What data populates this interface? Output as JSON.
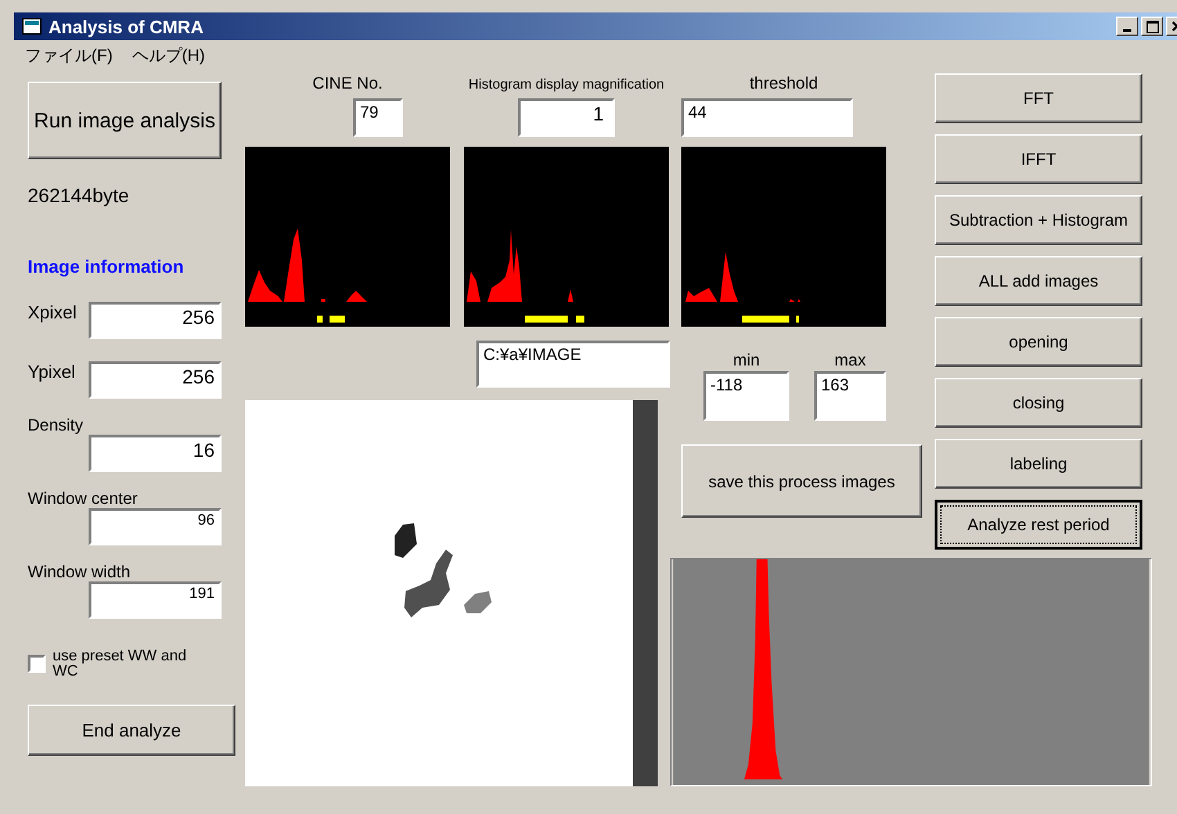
{
  "window": {
    "title": "Analysis of CMRA"
  },
  "menu": [
    {
      "label": "ファイル(F)"
    },
    {
      "label": "ヘルプ(H)"
    }
  ],
  "run_button": "Run image analysis",
  "file_size": "262144byte",
  "image_info_heading": "Image information",
  "info_fields": [
    {
      "label": "Xpixel",
      "value": "256",
      "kind": "inline"
    },
    {
      "label": "Ypixel",
      "value": "256",
      "kind": "inline"
    },
    {
      "label": "Density",
      "value": "16",
      "kind": "stacked"
    },
    {
      "label": "Window center",
      "value": "96",
      "kind": "stacked"
    },
    {
      "label": "Window width",
      "value": "191",
      "kind": "stacked"
    }
  ],
  "preset_checkbox": {
    "label": "use preset WW and WC",
    "checked": false
  },
  "end_button": "End analyze",
  "top_fields": [
    {
      "label": "CINE No.",
      "value": "79"
    },
    {
      "label": "Histogram display magnification",
      "value": "1"
    },
    {
      "label": "threshold",
      "value": "44"
    }
  ],
  "path_field": "C:¥a¥IMAGE",
  "range": [
    {
      "label": "min",
      "value": "-118"
    },
    {
      "label": "max",
      "value": "163"
    }
  ],
  "save_button": "save this process images",
  "actions": [
    {
      "label": "FFT",
      "focused": false
    },
    {
      "label": "IFFT",
      "focused": false
    },
    {
      "label": "Subtraction + Histogram",
      "focused": false
    },
    {
      "label": "ALL add images",
      "focused": false
    },
    {
      "label": "opening",
      "focused": false
    },
    {
      "label": "closing",
      "focused": false
    },
    {
      "label": "labeling",
      "focused": false
    },
    {
      "label": "Analyze rest period",
      "focused": true
    }
  ]
}
